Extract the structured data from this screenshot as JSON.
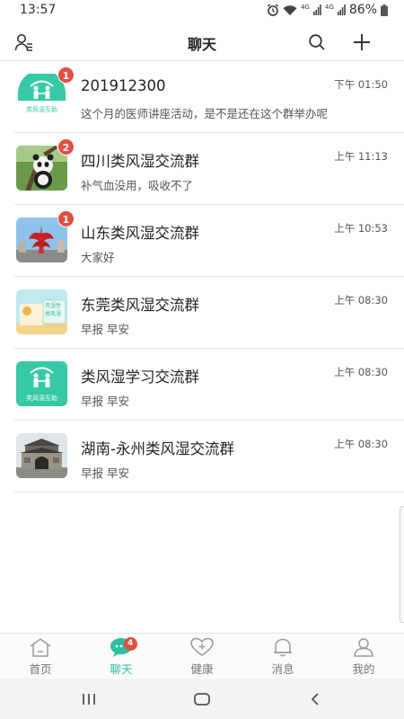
{
  "status_bar": {
    "time": "13:57",
    "battery": "86%",
    "network_labels": [
      "4G",
      "4G"
    ]
  },
  "header": {
    "title": "聊天"
  },
  "chats": [
    {
      "name": "201912300",
      "preview": "这个月的医师讲座活动，是不是还在这个群举办呢",
      "time": "下午 01:50",
      "badge": "1",
      "avatar_caption": "类风湿互助"
    },
    {
      "name": "四川类风湿交流群",
      "preview": "补气血没用，吸收不了",
      "time": "上午 11:13",
      "badge": "2"
    },
    {
      "name": "山东类风湿交流群",
      "preview": "大家好",
      "time": "上午 10:53",
      "badge": "1"
    },
    {
      "name": "东莞类风湿交流群",
      "preview": "早报 早安",
      "time": "上午 08:30",
      "badge": "",
      "avatar_text": "风湿性 类风湿"
    },
    {
      "name": "类风湿学习交流群",
      "preview": "早报 早安",
      "time": "上午 08:30",
      "badge": "",
      "avatar_caption": "类风湿互助"
    },
    {
      "name": "湖南-永州类风湿交流群",
      "preview": "早报 早安",
      "time": "上午 08:30",
      "badge": ""
    }
  ],
  "tabs": [
    {
      "label": "首页",
      "icon": "home-icon",
      "active": false
    },
    {
      "label": "聊天",
      "icon": "chat-bubble-icon",
      "active": true,
      "badge": "4"
    },
    {
      "label": "健康",
      "icon": "heart-plus-icon",
      "active": false
    },
    {
      "label": "消息",
      "icon": "bell-icon",
      "active": false
    },
    {
      "label": "我的",
      "icon": "person-icon",
      "active": false
    }
  ],
  "colors": {
    "accent": "#2bbfa0",
    "badge": "#e54d42",
    "logo_teal": "#35c9a6"
  }
}
